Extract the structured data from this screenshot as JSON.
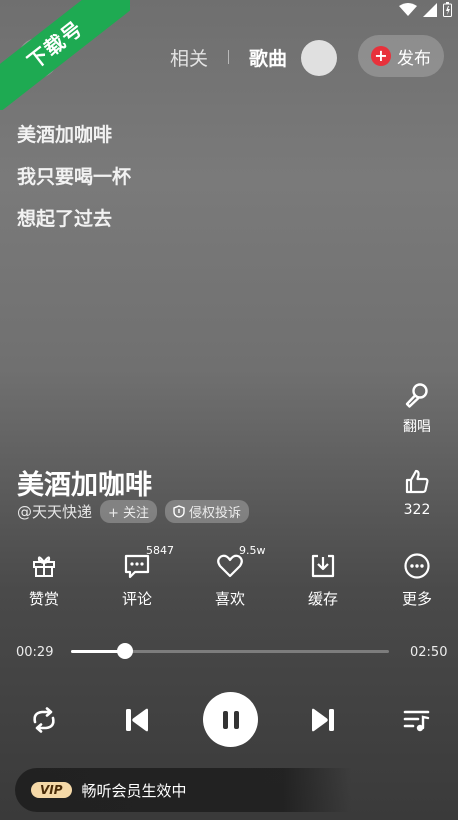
{
  "ribbon": {
    "text": "下载号",
    "color": "#1eaa52"
  },
  "tabs": {
    "related": "相关",
    "song": "歌曲"
  },
  "publish": {
    "label": "发布"
  },
  "lyrics": [
    "美酒加咖啡",
    "我只要喝一杯",
    "想起了过去"
  ],
  "side_actions": {
    "cover_label": "翻唱",
    "like_count": "322"
  },
  "song": {
    "title": "美酒加咖啡",
    "artist": "@天天快递",
    "follow_label": "+ 关注",
    "report_label": "侵权投诉"
  },
  "actions": [
    {
      "label": "赞赏",
      "icon": "gift-icon",
      "badge": ""
    },
    {
      "label": "评论",
      "icon": "comment-icon",
      "badge": "5847"
    },
    {
      "label": "喜欢",
      "icon": "heart-icon",
      "badge": "9.5w"
    },
    {
      "label": "缓存",
      "icon": "download-icon",
      "badge": ""
    },
    {
      "label": "更多",
      "icon": "more-icon",
      "badge": ""
    }
  ],
  "progress": {
    "current": "00:29",
    "total": "02:50",
    "fraction": 0.17
  },
  "vip": {
    "badge": "VIP",
    "text": "畅听会员生效中"
  }
}
